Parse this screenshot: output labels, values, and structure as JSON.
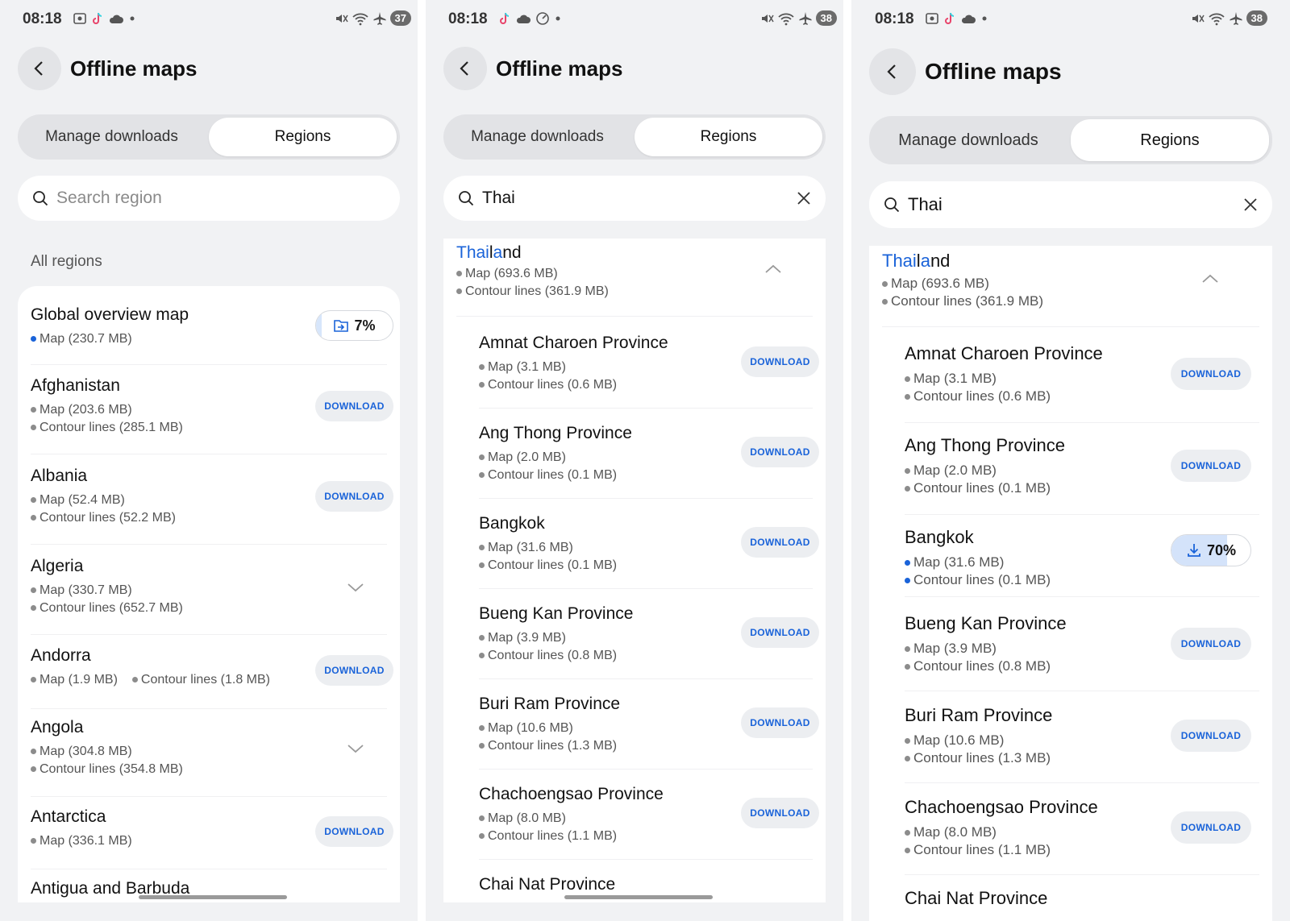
{
  "screens": [
    {
      "status": {
        "time": "08:18",
        "battery": "37"
      },
      "title": "Offline maps",
      "tabs": [
        "Manage downloads",
        "Regions"
      ],
      "search_placeholder": "Search region",
      "section": "All regions",
      "items": [
        {
          "name": "Global overview map",
          "sub1": "Map (230.7 MB)",
          "progress": "7%"
        },
        {
          "name": "Afghanistan",
          "sub1": "Map (203.6 MB)",
          "sub2": "Contour lines (285.1 MB)",
          "action": "DOWNLOAD"
        },
        {
          "name": "Albania",
          "sub1": "Map (52.4 MB)",
          "sub2": "Contour lines (52.2 MB)",
          "action": "DOWNLOAD"
        },
        {
          "name": "Algeria",
          "sub1": "Map (330.7 MB)",
          "sub2": "Contour lines (652.7 MB)"
        },
        {
          "name": "Andorra",
          "sub1": "Map (1.9 MB)",
          "sub2": "Contour lines (1.8 MB)",
          "action": "DOWNLOAD"
        },
        {
          "name": "Angola",
          "sub1": "Map (304.8 MB)",
          "sub2": "Contour lines (354.8 MB)"
        },
        {
          "name": "Antarctica",
          "sub1": "Map (336.1 MB)",
          "action": "DOWNLOAD"
        },
        {
          "name": "Antigua and Barbuda"
        }
      ]
    },
    {
      "status": {
        "time": "08:18",
        "battery": "38"
      },
      "title": "Offline maps",
      "tabs": [
        "Manage downloads",
        "Regions"
      ],
      "search_value": "Thai",
      "country": {
        "name_hl": "Thai",
        "name_mid": "l",
        "name_hl2": "a",
        "name_rest": "nd",
        "sub1": "Map (693.6 MB)",
        "sub2": "Contour lines (361.9 MB)"
      },
      "items": [
        {
          "name": "Amnat Charoen Province",
          "sub1": "Map (3.1 MB)",
          "sub2": "Contour lines (0.6 MB)",
          "action": "DOWNLOAD"
        },
        {
          "name": "Ang Thong Province",
          "sub1": "Map (2.0 MB)",
          "sub2": "Contour lines (0.1 MB)",
          "action": "DOWNLOAD"
        },
        {
          "name": "Bangkok",
          "sub1": "Map (31.6 MB)",
          "sub2": "Contour lines (0.1 MB)",
          "action": "DOWNLOAD"
        },
        {
          "name": "Bueng Kan Province",
          "sub1": "Map (3.9 MB)",
          "sub2": "Contour lines (0.8 MB)",
          "action": "DOWNLOAD"
        },
        {
          "name": "Buri Ram Province",
          "sub1": "Map (10.6 MB)",
          "sub2": "Contour lines (1.3 MB)",
          "action": "DOWNLOAD"
        },
        {
          "name": "Chachoengsao Province",
          "sub1": "Map (8.0 MB)",
          "sub2": "Contour lines (1.1 MB)",
          "action": "DOWNLOAD"
        },
        {
          "name": "Chai Nat Province"
        }
      ]
    },
    {
      "status": {
        "time": "08:18",
        "battery": "38"
      },
      "title": "Offline maps",
      "tabs": [
        "Manage downloads",
        "Regions"
      ],
      "search_value": "Thai",
      "country": {
        "name_hl": "Thai",
        "name_mid": "l",
        "name_hl2": "a",
        "name_rest": "nd",
        "sub1": "Map (693.6 MB)",
        "sub2": "Contour lines (361.9 MB)"
      },
      "items": [
        {
          "name": "Amnat Charoen Province",
          "sub1": "Map (3.1 MB)",
          "sub2": "Contour lines (0.6 MB)",
          "action": "DOWNLOAD"
        },
        {
          "name": "Ang Thong Province",
          "sub1": "Map (2.0 MB)",
          "sub2": "Contour lines (0.1 MB)",
          "action": "DOWNLOAD"
        },
        {
          "name": "Bangkok",
          "sub1": "Map (31.6 MB)",
          "sub2": "Contour lines (0.1 MB)",
          "progress": "70%"
        },
        {
          "name": "Bueng Kan Province",
          "sub1": "Map (3.9 MB)",
          "sub2": "Contour lines (0.8 MB)",
          "action": "DOWNLOAD"
        },
        {
          "name": "Buri Ram Province",
          "sub1": "Map (10.6 MB)",
          "sub2": "Contour lines (1.3 MB)",
          "action": "DOWNLOAD"
        },
        {
          "name": "Chachoengsao Province",
          "sub1": "Map (8.0 MB)",
          "sub2": "Contour lines (1.1 MB)",
          "action": "DOWNLOAD"
        },
        {
          "name": "Chai Nat Province"
        }
      ]
    }
  ],
  "colors": {
    "accent": "#1a63d9",
    "background": "#f1f2f4",
    "card": "#ffffff",
    "button_bg": "#eceef1"
  }
}
